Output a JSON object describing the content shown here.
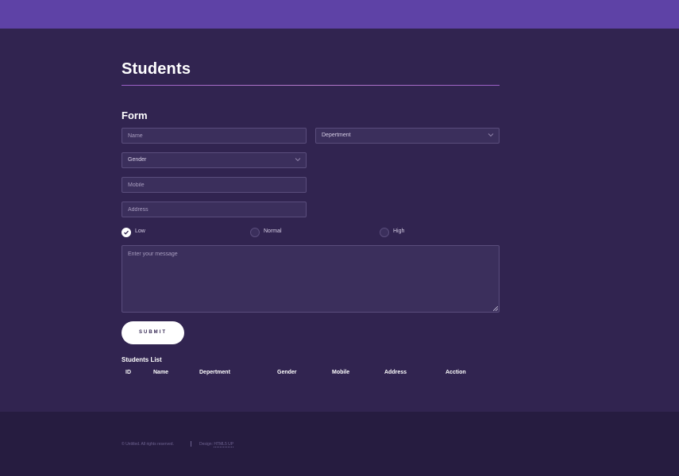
{
  "colors": {
    "header_bar": "#5e42a6",
    "page_background": "#312450",
    "footer_background": "#261c40",
    "field_background": "#3b2f5c",
    "title_rule": "#b57ac9"
  },
  "page": {
    "title": "Students"
  },
  "form": {
    "title": "Form",
    "name_placeholder": "Name",
    "department_label": "Depertment",
    "gender_label": "Gender",
    "mobile_placeholder": "Mobile",
    "address_placeholder": "Address",
    "priority": {
      "options": [
        "Low",
        "Normal",
        "High"
      ],
      "selected": "Low"
    },
    "message_placeholder": "Enter your message",
    "submit_label": "SUBMIT"
  },
  "students_list": {
    "title": "Students List",
    "columns": [
      "ID",
      "Name",
      "Depertment",
      "Gender",
      "Mobile",
      "Address",
      "Acction"
    ],
    "rows": []
  },
  "footer": {
    "copyright": "© Untitled. All rights reserved.",
    "design_prefix": "Design:",
    "design_link": "HTML5 UP"
  }
}
